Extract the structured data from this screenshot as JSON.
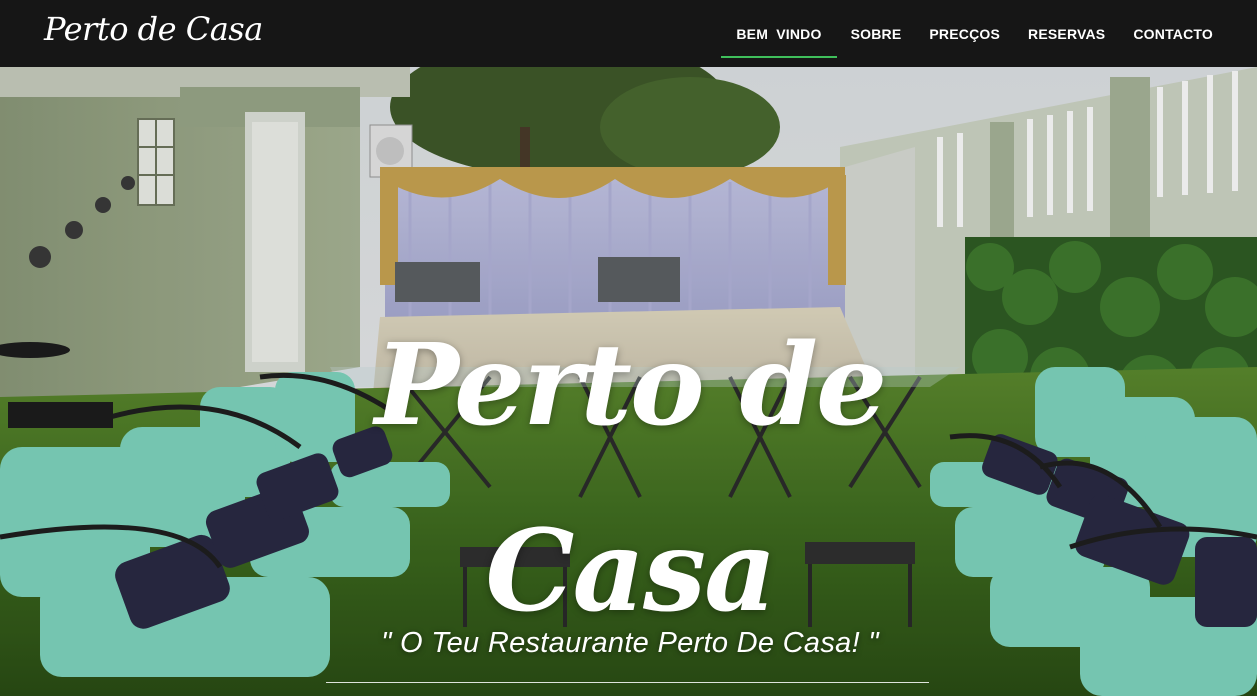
{
  "brand": {
    "name": "Perto de Casa"
  },
  "nav": {
    "items": [
      {
        "label": "BEM  VINDO",
        "active": true
      },
      {
        "label": "SOBRE",
        "active": false
      },
      {
        "label": "PRECÇOS",
        "active": false
      },
      {
        "label": "RESERVAS",
        "active": false
      },
      {
        "label": "CONTACTO",
        "active": false
      }
    ]
  },
  "hero": {
    "title_line1": "Perto de",
    "title_line2": "Casa",
    "tagline": "\" O Teu Restaurante Perto De Casa! \""
  },
  "colors": {
    "navbar_bg": "#161616",
    "active_underline": "#3fbf5b",
    "text": "#ffffff"
  }
}
